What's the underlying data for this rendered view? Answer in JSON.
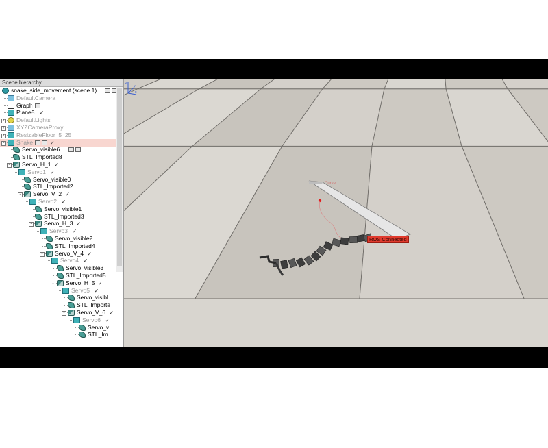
{
  "hierarchy": {
    "title": "Scene hierarchy",
    "items": [
      {
        "label": "snake_side_movement (scene 1)",
        "icon": "scene-icon",
        "dim": false
      },
      {
        "label": "DefaultCamera",
        "icon": "camera-icon",
        "dim": true
      },
      {
        "label": "Graph",
        "icon": "graph-icon",
        "dim": false
      },
      {
        "label": "Plane5",
        "icon": "cube-icon",
        "dim": false
      },
      {
        "label": "DefaultLights",
        "icon": "light-icon",
        "dim": true
      },
      {
        "label": "XYZCameraProxy",
        "icon": "camera-icon",
        "dim": true
      },
      {
        "label": "ResizableFloor_5_25",
        "icon": "cube-icon",
        "dim": true
      },
      {
        "label": "Snake",
        "icon": "cube-icon",
        "dim": true,
        "selected": true
      },
      {
        "label": "Servo_visible6",
        "icon": "shape-icon",
        "dim": false
      },
      {
        "label": "STL_Imported8",
        "icon": "shape-icon",
        "dim": false
      },
      {
        "label": "Servo_H_1",
        "icon": "joint-icon",
        "dim": false
      },
      {
        "label": "Servo1",
        "icon": "cube-icon",
        "dim": true
      },
      {
        "label": "Servo_visible0",
        "icon": "shape-icon",
        "dim": false
      },
      {
        "label": "STL_Imported2",
        "icon": "shape-icon",
        "dim": false
      },
      {
        "label": "Servo_V_2",
        "icon": "joint-icon",
        "dim": false
      },
      {
        "label": "Servo2",
        "icon": "cube-icon",
        "dim": true
      },
      {
        "label": "Servo_visible1",
        "icon": "shape-icon",
        "dim": false
      },
      {
        "label": "STL_Imported3",
        "icon": "shape-icon",
        "dim": false
      },
      {
        "label": "Servo_H_3",
        "icon": "joint-icon",
        "dim": false
      },
      {
        "label": "Servo3",
        "icon": "cube-icon",
        "dim": true
      },
      {
        "label": "Servo_visible2",
        "icon": "shape-icon",
        "dim": false
      },
      {
        "label": "STL_Imported4",
        "icon": "shape-icon",
        "dim": false
      },
      {
        "label": "Servo_V_4",
        "icon": "joint-icon",
        "dim": false
      },
      {
        "label": "Servo4",
        "icon": "cube-icon",
        "dim": true
      },
      {
        "label": "Servo_visible3",
        "icon": "shape-icon",
        "dim": false
      },
      {
        "label": "STL_Imported5",
        "icon": "shape-icon",
        "dim": false
      },
      {
        "label": "Servo_H_5",
        "icon": "joint-icon",
        "dim": false
      },
      {
        "label": "Servo5",
        "icon": "cube-icon",
        "dim": true
      },
      {
        "label": "Servo_visibl",
        "icon": "shape-icon",
        "dim": false
      },
      {
        "label": "STL_Importe",
        "icon": "shape-icon",
        "dim": false
      },
      {
        "label": "Servo_V_6",
        "icon": "joint-icon",
        "dim": false
      },
      {
        "label": "Servo6",
        "icon": "cube-icon",
        "dim": true
      },
      {
        "label": "Servo_v",
        "icon": "shape-icon",
        "dim": false
      },
      {
        "label": "STL_Im",
        "icon": "shape-icon",
        "dim": false
      }
    ]
  },
  "viewport": {
    "ros_label": "ROS Connected",
    "path_label": "Curve",
    "ros_label_color": "#e03b2e",
    "floor_color": "#d8d5cf",
    "tile_line_color": "#6f6c68"
  }
}
